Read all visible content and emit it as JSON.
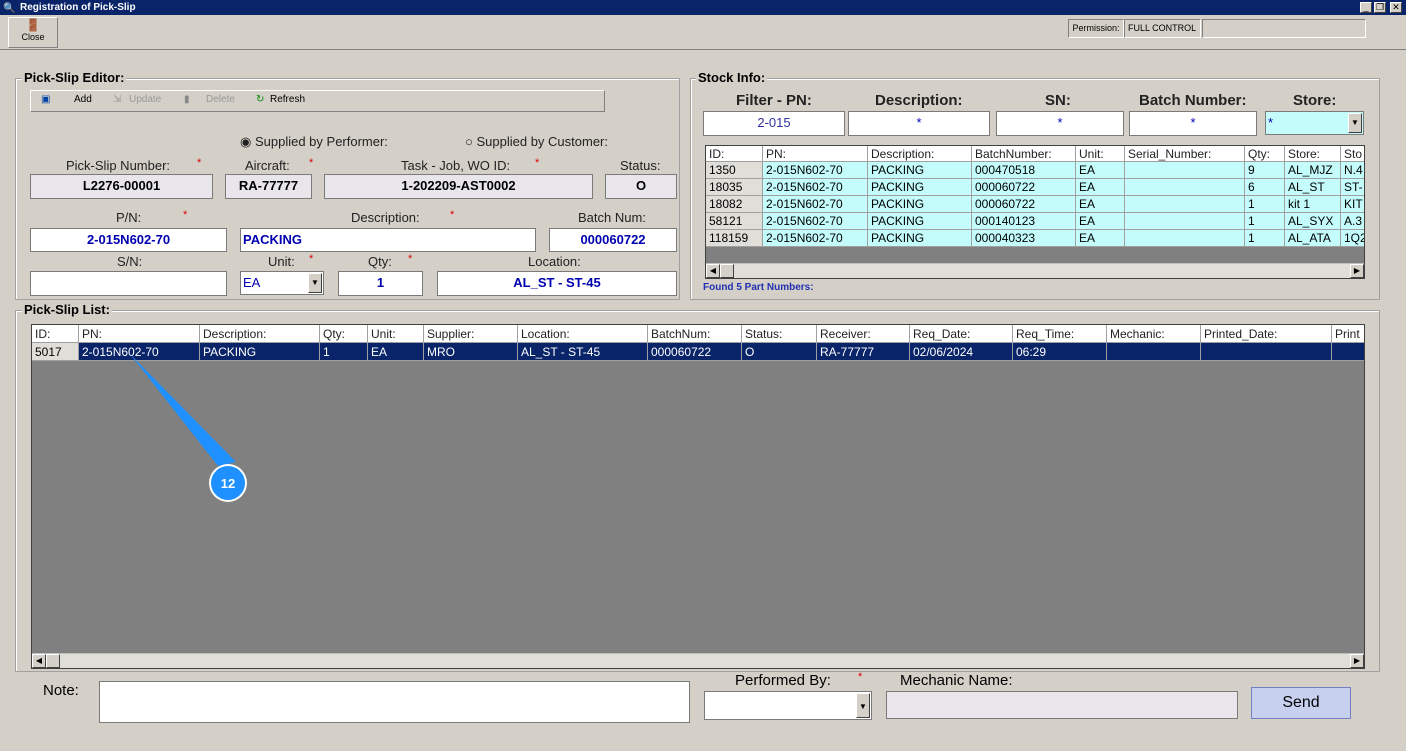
{
  "window": {
    "title": "Registration of Pick-Slip",
    "controls": [
      "_",
      "❐",
      "✕"
    ]
  },
  "toolbar": {
    "close_label": "Close",
    "permission_label": "Permission:",
    "permission_value": "FULL CONTROL"
  },
  "editor": {
    "title": "Pick-Slip Editor:",
    "buttons": {
      "add": "Add",
      "update": "Update",
      "delete": "Delete",
      "refresh": "Refresh"
    },
    "radio_performer": "Supplied by Performer:",
    "radio_customer": "Supplied by Customer:",
    "radio_selected": "performer",
    "labels": {
      "pick_slip_number": "Pick-Slip Number:",
      "aircraft": "Aircraft:",
      "task": "Task - Job, WO ID:",
      "status": "Status:",
      "pn": "P/N:",
      "description": "Description:",
      "batch": "Batch Num:",
      "sn": "S/N:",
      "unit": "Unit:",
      "qty": "Qty:",
      "location": "Location:"
    },
    "required_mark": "*",
    "values": {
      "pick_slip_number": "L2276-00001",
      "aircraft": "RA-77777",
      "task": "1-202209-AST0002",
      "status": "O",
      "pn": "2-015N602-70",
      "description": "PACKING",
      "batch": "000060722",
      "sn": "",
      "unit": "EA",
      "qty": "1",
      "location": "AL_ST - ST-45"
    }
  },
  "stock": {
    "title": "Stock Info:",
    "filter_labels": {
      "pn": "Filter - PN:",
      "description": "Description:",
      "sn": "SN:",
      "batch": "Batch Number:",
      "store": "Store:"
    },
    "filter_values": {
      "pn": "2-015",
      "description": "*",
      "sn": "*",
      "batch": "*",
      "store": "*"
    },
    "columns": [
      "ID:",
      "PN:",
      "Description:",
      "BatchNumber:",
      "Unit:",
      "Serial_Number:",
      "Qty:",
      "Store:",
      "Sto"
    ],
    "rows": [
      [
        "1350",
        "2-015N602-70",
        "PACKING",
        "000470518",
        "EA",
        "",
        "9",
        "AL_MJZ",
        "N.4"
      ],
      [
        "18035",
        "2-015N602-70",
        "PACKING",
        "000060722",
        "EA",
        "",
        "6",
        "AL_ST",
        "ST-"
      ],
      [
        "18082",
        "2-015N602-70",
        "PACKING",
        "000060722",
        "EA",
        "",
        "1",
        "kit 1",
        "KIT"
      ],
      [
        "58121",
        "2-015N602-70",
        "PACKING",
        "000140123",
        "EA",
        "",
        "1",
        "AL_SYX",
        "A.3"
      ],
      [
        "118159",
        "2-015N602-70",
        "PACKING",
        "000040323",
        "EA",
        "",
        "1",
        "AL_ATA",
        "1Q2"
      ]
    ],
    "found_text": "Found 5 Part Numbers:"
  },
  "list": {
    "title": "Pick-Slip List:",
    "columns": [
      "ID:",
      "PN:",
      "Description:",
      "Qty:",
      "Unit:",
      "Supplier:",
      "Location:",
      "BatchNum:",
      "Status:",
      "Receiver:",
      "Req_Date:",
      "Req_Time:",
      "Mechanic:",
      "Printed_Date:",
      "Print"
    ],
    "rows": [
      [
        "5017",
        "2-015N602-70",
        "PACKING",
        "1",
        "EA",
        "MRO",
        "AL_ST - ST-45",
        "000060722",
        "O",
        "RA-77777",
        "02/06/2024",
        "06:29",
        "",
        "",
        ""
      ]
    ]
  },
  "footer": {
    "note_label": "Note:",
    "note_value": "",
    "performed_by_label": "Performed By:",
    "performed_by_value": "",
    "mechanic_name_label": "Mechanic  Name:",
    "mechanic_name_value": "",
    "send_label": "Send"
  },
  "annotation": {
    "marker": "12"
  },
  "colors": {
    "titlebar": "#0a246a",
    "stock_row_bg": "#c4fcfc",
    "selected_row": "#0a246a",
    "marker": "#1e90ff"
  }
}
